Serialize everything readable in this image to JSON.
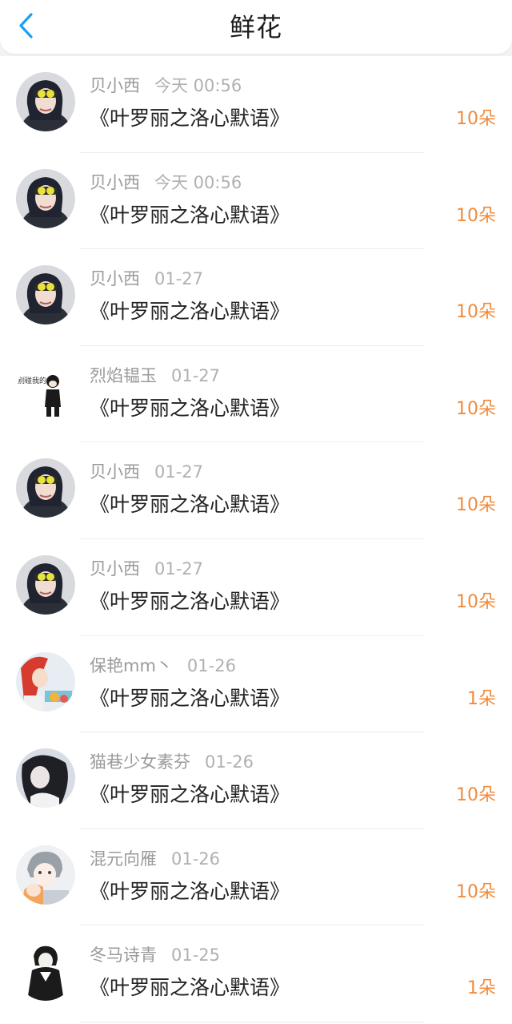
{
  "header": {
    "title": "鲜花"
  },
  "book_title": "《叶罗丽之洛心默语》",
  "items": [
    {
      "user": "贝小西",
      "date": "今天 00:56",
      "count": "10朵",
      "avatar": "masked-girl"
    },
    {
      "user": "贝小西",
      "date": "今天 00:56",
      "count": "10朵",
      "avatar": "masked-girl"
    },
    {
      "user": "贝小西",
      "date": "01-27",
      "count": "10朵",
      "avatar": "masked-girl"
    },
    {
      "user": "烈焰韫玉",
      "date": "01-27",
      "count": "10朵",
      "avatar": "cartoon-boy"
    },
    {
      "user": "贝小西",
      "date": "01-27",
      "count": "10朵",
      "avatar": "masked-girl"
    },
    {
      "user": "贝小西",
      "date": "01-27",
      "count": "10朵",
      "avatar": "masked-girl"
    },
    {
      "user": "保艳mm丶",
      "date": "01-26",
      "count": "1朵",
      "avatar": "red-hair-girl"
    },
    {
      "user": "猫巷少女素芬",
      "date": "01-26",
      "count": "10朵",
      "avatar": "dark-hair-girl"
    },
    {
      "user": "混元向雁",
      "date": "01-26",
      "count": "10朵",
      "avatar": "anime-boys"
    },
    {
      "user": "冬马诗青",
      "date": "01-25",
      "count": "1朵",
      "avatar": "sketch-boy"
    }
  ],
  "colors": {
    "accent_blue": "#1e9ff2",
    "count_orange": "#f08a3c",
    "text_gray": "#9a9a9a",
    "text_dark": "#222222"
  },
  "icons": {
    "back": "chevron-left-icon"
  }
}
